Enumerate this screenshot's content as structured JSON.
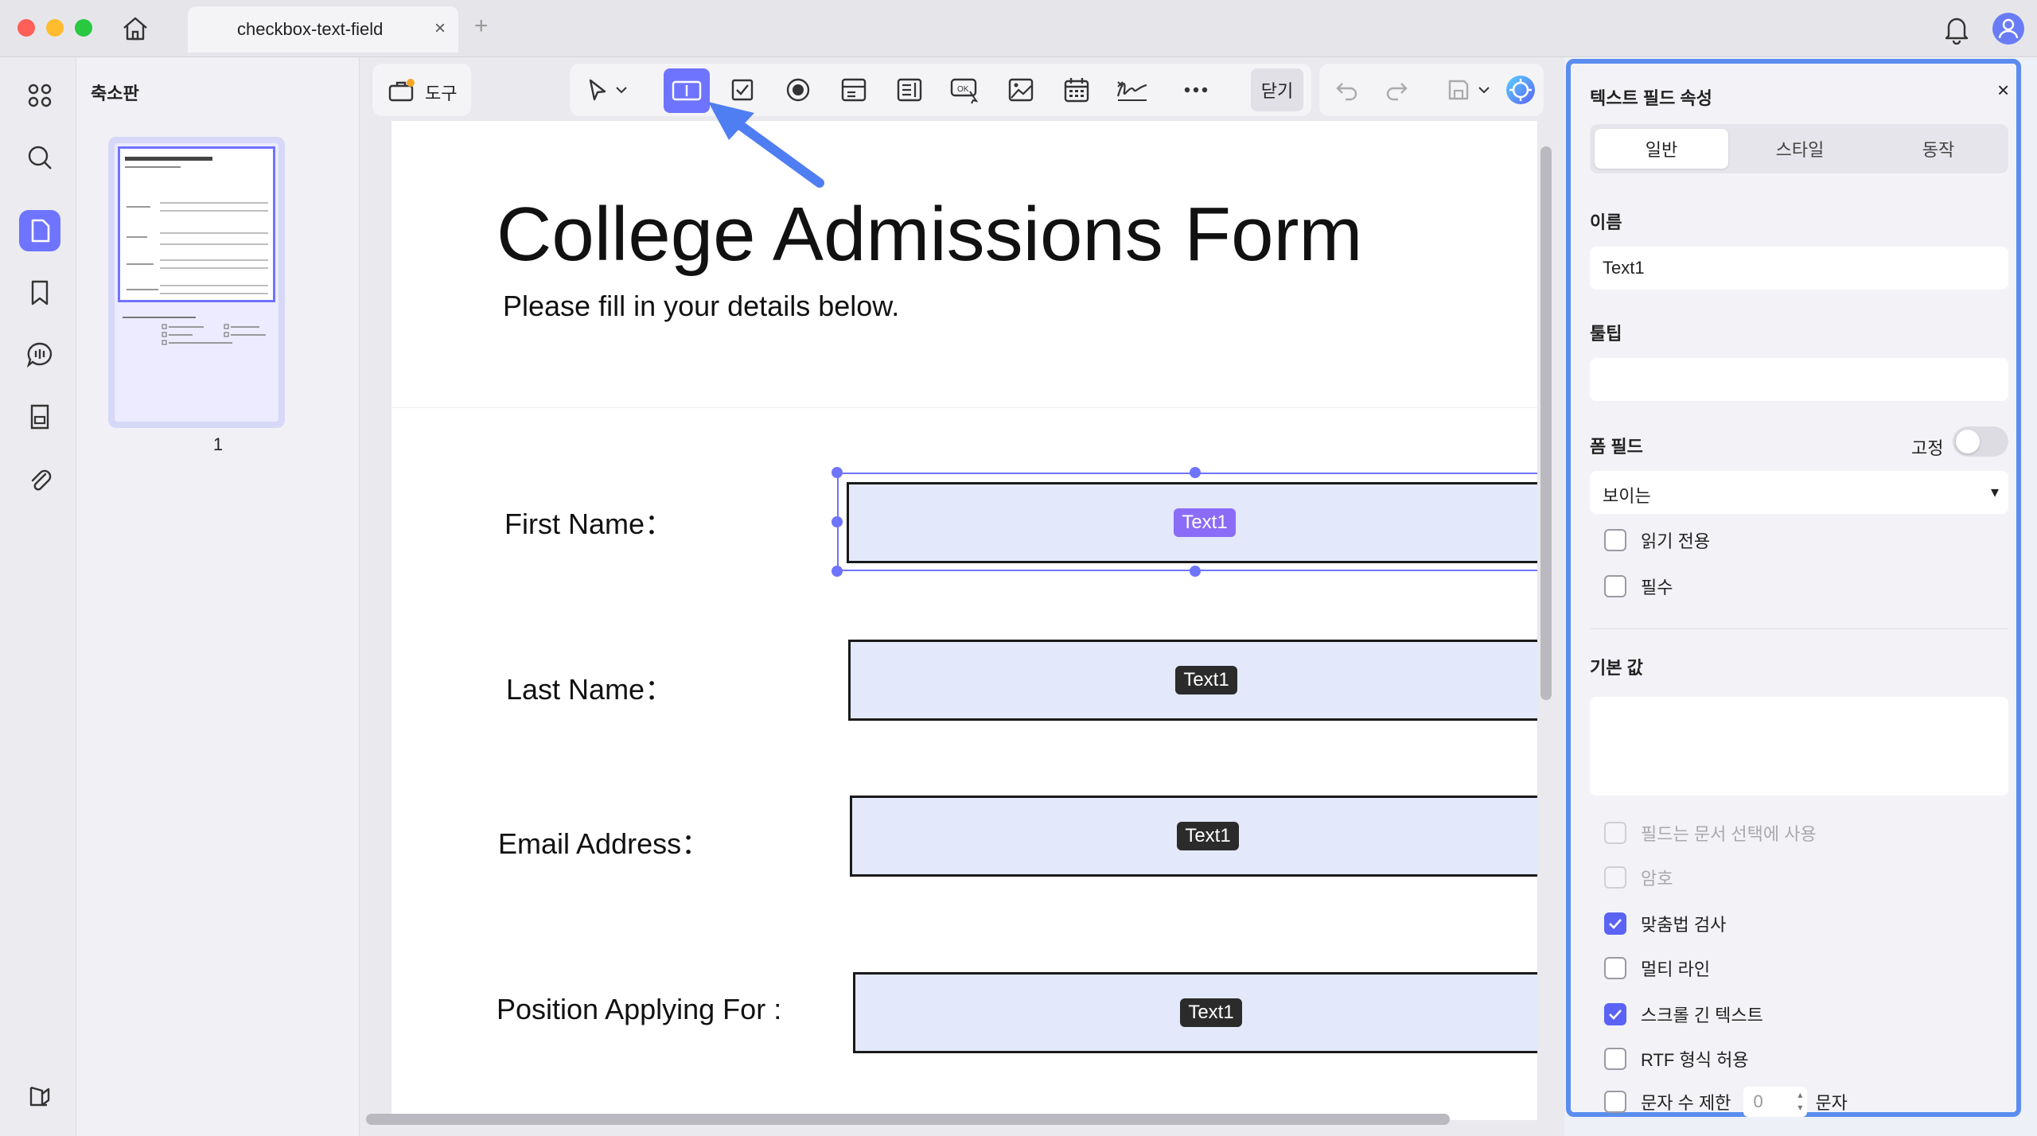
{
  "window": {
    "tab_title": "checkbox-text-field",
    "tab_close": "×",
    "tab_add": "+"
  },
  "thumbnails": {
    "title": "축소판",
    "page_number": "1"
  },
  "toolbar": {
    "tools_label": "도구",
    "close_label": "닫기"
  },
  "document": {
    "title": "College Admissions Form",
    "subtitle": "Please fill in your details below.",
    "fields": [
      {
        "label": "First Name：",
        "badge": "Text1"
      },
      {
        "label": "Last Name：",
        "badge": "Text1"
      },
      {
        "label": "Email Address：",
        "badge": "Text1"
      },
      {
        "label": "Position Applying For :",
        "badge": "Text1"
      }
    ]
  },
  "panel": {
    "title": "텍스트 필드 속성",
    "close": "×",
    "tabs": [
      "일반",
      "스타일",
      "동작"
    ],
    "name_label": "이름",
    "name_value": "Text1",
    "tooltip_label": "툴팁",
    "form_field_label": "폼 필드",
    "fixed_label": "고정",
    "visibility_value": "보이는",
    "visibility_arrow": "▾",
    "default_label": "기본 값",
    "checkboxes": [
      {
        "label": "읽기 전용",
        "checked": false,
        "disabled": false
      },
      {
        "label": "필수",
        "checked": false,
        "disabled": false
      }
    ],
    "options": [
      {
        "label": "필드는 문서 선택에 사용",
        "checked": false,
        "disabled": true
      },
      {
        "label": "암호",
        "checked": false,
        "disabled": true
      },
      {
        "label": "맞춤법 검사",
        "checked": true,
        "disabled": false
      },
      {
        "label": "멀티 라인",
        "checked": false,
        "disabled": false
      },
      {
        "label": "스크롤 긴 텍스트",
        "checked": true,
        "disabled": false
      },
      {
        "label": "RTF 형식 허용",
        "checked": false,
        "disabled": false
      }
    ],
    "char_limit": {
      "label": "문자 수 제한",
      "value": "0",
      "suffix": "문자"
    }
  },
  "colors": {
    "accent": "#6f74ff",
    "panel_border": "#5b8def",
    "field_fill": "#e3e8fb",
    "selected_badge": "#8b6cf6"
  },
  "icons": {
    "rail": [
      "grid-icon",
      "search-icon",
      "pages-icon",
      "bookmark-icon",
      "comment-icon",
      "form-icon",
      "attachment-icon",
      "library-icon"
    ],
    "toolbar": [
      "pointer-icon",
      "text-field-icon",
      "checkbox-icon",
      "radio-icon",
      "combo-box-icon",
      "list-box-icon",
      "button-icon",
      "image-field-icon",
      "date-icon",
      "signature-icon",
      "more-icon",
      "undo-icon",
      "redo-icon",
      "save-icon",
      "ai-icon"
    ]
  }
}
